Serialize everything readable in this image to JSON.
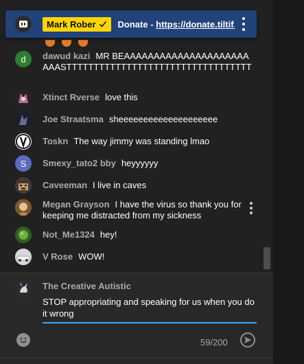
{
  "pinned": {
    "owner": "Mark Rober",
    "owner_badge_icon": "checkmark-icon",
    "text": "Donate - ",
    "link": "https://donate.tiltif..."
  },
  "messages": [
    {
      "author": "dawud kazi",
      "text": "MR BEAAAAAAAAAAAAAAAAAAAAAAAASTTTTTTTTTTTTTTTTTTTTTTTTTTTTTTTTTT",
      "avatar_letter": "d",
      "avatar_color": "#2e7d32"
    },
    {
      "author": "Xtinct Rverse",
      "text": "love this"
    },
    {
      "author": "Joe Straatsma",
      "text": "sheeeeeeeeeeeeeeeeeeee"
    },
    {
      "author": "Toskn",
      "text": "The way jimmy was standing lmao"
    },
    {
      "author": "Smexy_tato2 bby",
      "text": "heyyyyyy",
      "avatar_letter": "S",
      "avatar_color": "#5c6bc0"
    },
    {
      "author": "Caveeman",
      "text": "I live in caves"
    },
    {
      "author": "Megan Grayson",
      "text": "I have the virus so thank you for keeping me distracted from my sickness"
    },
    {
      "author": "Not_Me1324",
      "text": "hey!"
    },
    {
      "author": "V Rose",
      "text": "WOW!"
    }
  ],
  "input": {
    "author": "The Creative Autistic",
    "value": "STOP appropriating and speaking for us when you do it wrong",
    "counter": "59/200"
  },
  "colors": {
    "pinned_bg": "#22427a",
    "owner_badge": "#ffd600",
    "focus_line": "#3ea6ff"
  }
}
